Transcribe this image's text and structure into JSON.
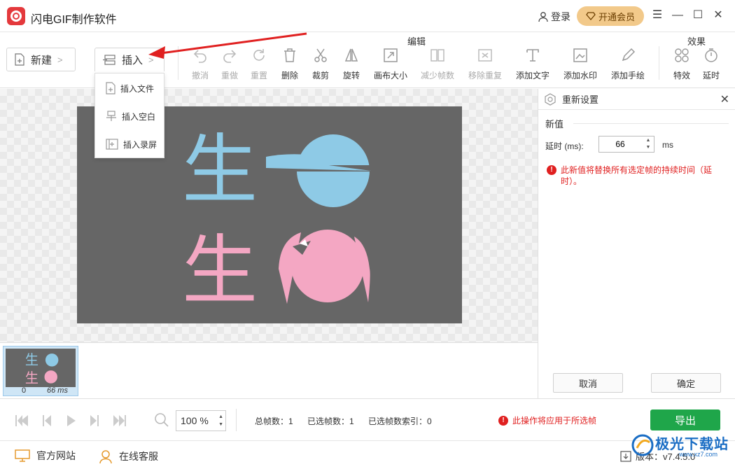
{
  "titlebar": {
    "app_title": "闪电GIF制作软件",
    "login": "登录",
    "vip": "开通会员",
    "menu_icon": "hamburger-icon",
    "minimize_icon": "minimize-icon",
    "maximize_icon": "maximize-icon",
    "close_icon": "close-icon"
  },
  "toolbar": {
    "new_label": "新建",
    "insert_label": "插入",
    "edit_group": "编辑",
    "effect_group": "效果",
    "tools": [
      {
        "label": "撤消",
        "enabled": false
      },
      {
        "label": "重做",
        "enabled": false
      },
      {
        "label": "重置",
        "enabled": false
      },
      {
        "label": "删除",
        "enabled": true
      },
      {
        "label": "裁剪",
        "enabled": true
      },
      {
        "label": "旋转",
        "enabled": true
      },
      {
        "label": "画布大小",
        "enabled": true
      },
      {
        "label": "减少帧数",
        "enabled": false
      },
      {
        "label": "移除重复",
        "enabled": false
      },
      {
        "label": "添加文字",
        "enabled": true
      },
      {
        "label": "添加水印",
        "enabled": true
      },
      {
        "label": "添加手绘",
        "enabled": true
      }
    ],
    "effects": [
      {
        "label": "特效"
      },
      {
        "label": "延时"
      }
    ]
  },
  "insert_menu": {
    "items": [
      {
        "label": "插入文件",
        "icon": "insert-file-icon"
      },
      {
        "label": "插入空白",
        "icon": "insert-blank-icon"
      },
      {
        "label": "插入录屏",
        "icon": "insert-recording-icon"
      }
    ]
  },
  "preview": {
    "glyph": "生",
    "colors": {
      "blue": "#8ecae6",
      "pink": "#f4a7c3",
      "bg": "#666666"
    }
  },
  "filmstrip": {
    "frames": [
      {
        "index": "0",
        "duration": "66 ms"
      }
    ]
  },
  "panel": {
    "title": "重新设置",
    "section": "新值",
    "delay_label": "延时 (ms):",
    "delay_value": "66",
    "unit": "ms",
    "warning": "此新值将替换所有选定帧的持续时间（延时）。",
    "cancel": "取消",
    "confirm": "确定"
  },
  "bottombar": {
    "zoom": "100",
    "zoom_unit": "%",
    "total_frames": "总帧数：1",
    "selected_frames": "已选帧数：1",
    "selected_index": "已选帧数索引：0",
    "apply_note": "此操作将应用于所选帧",
    "export": "导出"
  },
  "footer": {
    "website": "官方网站",
    "support": "在线客服",
    "version": "版本：v7.4.5.0"
  },
  "watermark": {
    "text": "极光下载站",
    "url": "www.xz7.com"
  }
}
